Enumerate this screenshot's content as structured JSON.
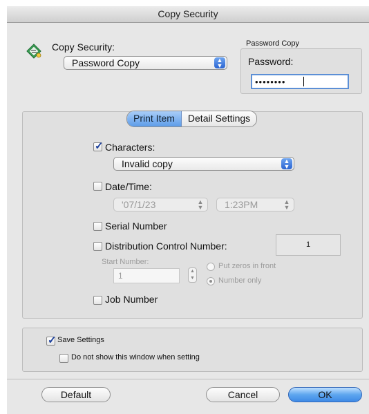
{
  "window": {
    "title": "Copy Security"
  },
  "copy_security": {
    "label": "Copy Security:",
    "selected": "Password Copy",
    "icon": "copy-security-icon"
  },
  "password_box": {
    "heading": "Password Copy",
    "label": "Password:",
    "masked_value": "••••••••"
  },
  "tabs": [
    {
      "label": "Print Item",
      "selected": true
    },
    {
      "label": "Detail Settings",
      "selected": false
    }
  ],
  "print_item": {
    "characters": {
      "label": "Characters:",
      "checked": true,
      "option": "Invalid copy"
    },
    "date_time": {
      "label": "Date/Time:",
      "checked": false,
      "date": "'07/1/23",
      "time": "1:23PM"
    },
    "serial_number": {
      "label": "Serial Number",
      "checked": false
    },
    "distribution_control": {
      "label": "Distribution Control Number:",
      "checked": false,
      "value": "1"
    },
    "start_number": {
      "label": "Start Number:",
      "value": "1"
    },
    "zero_options": [
      {
        "label": "Put zeros in front",
        "selected": false
      },
      {
        "label": "Number only",
        "selected": true
      }
    ],
    "job_number": {
      "label": "Job Number",
      "checked": false
    }
  },
  "save_settings": {
    "label": "Save Settings",
    "checked": true
  },
  "do_not_show": {
    "label": "Do not show this window when setting",
    "checked": false
  },
  "buttons": {
    "default": "Default",
    "cancel": "Cancel",
    "ok": "OK"
  },
  "colors": {
    "accent": "#5ea6ef",
    "window_bg": "#e7e7e7",
    "check_mark": "#1b3f9c"
  }
}
